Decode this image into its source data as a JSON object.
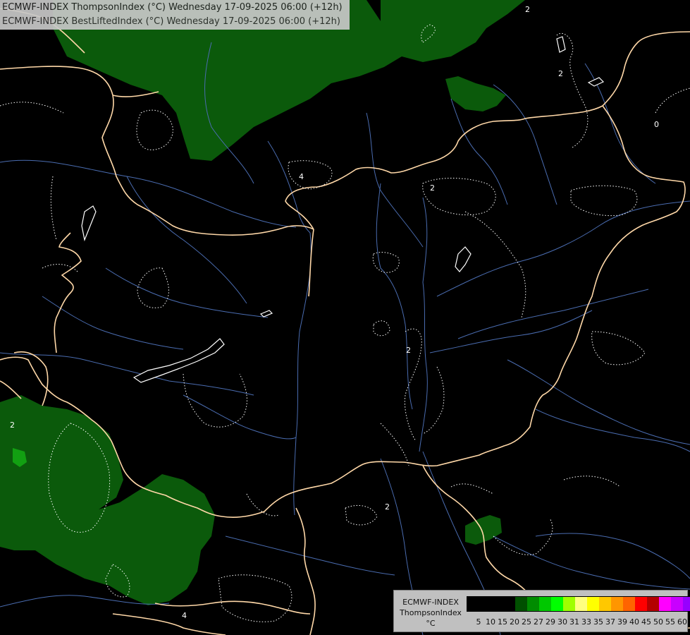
{
  "header": {
    "line1": "ECMWF-INDEX ThompsonIndex (°C) Wednesday 17-09-2025 06:00 (+12h)",
    "line2": "ECMWF-INDEX BestLiftedIndex (°C) Wednesday 17-09-2025 06:00 (+12h)"
  },
  "legend": {
    "title1": "ECMWF-INDEX",
    "title2": "ThompsonIndex",
    "unit": "°C",
    "colors": [
      "#000000",
      "#000000",
      "#000000",
      "#000000",
      "#005000",
      "#008c00",
      "#00c800",
      "#00ff00",
      "#a0ff00",
      "#ffff80",
      "#ffff00",
      "#ffc800",
      "#ff9600",
      "#ff6400",
      "#ff0000",
      "#b40000",
      "#ff00ff",
      "#c800ff",
      "#9600ff",
      "#6400ff",
      "#0000ff"
    ],
    "ticks": [
      "5",
      "10",
      "15",
      "20",
      "25",
      "27",
      "29",
      "30",
      "31",
      "33",
      "35",
      "37",
      "39",
      "40",
      "45",
      "50",
      "55",
      "60"
    ]
  },
  "contour_labels": [
    "2",
    "2",
    "2",
    "4",
    "2",
    "2",
    "2",
    "0",
    "4"
  ],
  "colors": {
    "fill_green": "#0b5a0b",
    "fill_bright": "#12a012",
    "border": "#ffd8a8",
    "river": "#4a6cb0",
    "contour": "#ffffff"
  }
}
